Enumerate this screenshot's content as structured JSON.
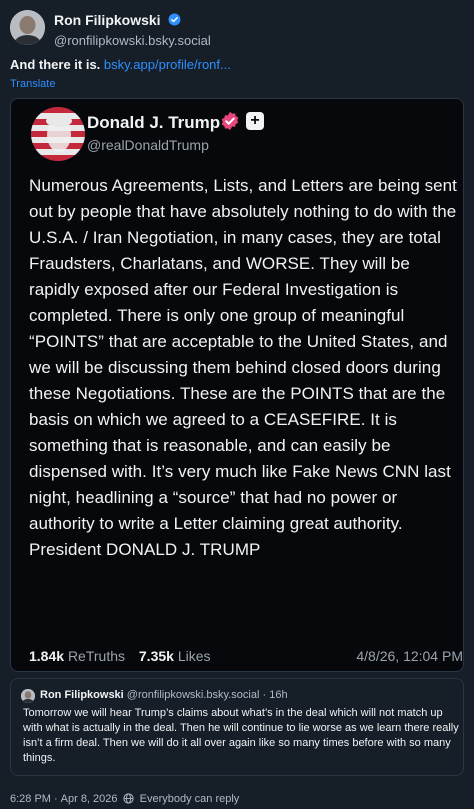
{
  "post": {
    "author_name": "Ron Filipkowski",
    "author_handle": "@ronfilipkowski.bsky.social",
    "text": "And there it is.",
    "link_text": "bsky.app/profile/ronf...",
    "translate_label": "Translate"
  },
  "embed": {
    "author_name": "Donald J. Trump",
    "author_handle": "@realDonaldTrump",
    "body": "Numerous Agreements, Lists, and Letters are being sent out by people that have absolutely nothing to do with the U.S.A. / Iran Negotiation, in many cases, they are total Fraudsters, Charlatans, and WORSE. They will be rapidly exposed after our Federal Investigation is completed. There is only one group of meaningful “POINTS” that are acceptable to the United States, and we will be discussing them behind closed doors during these Negotiations. These are the POINTS that are the basis on which we agreed to a CEASEFIRE. It is something that is reasonable, and can easily be dispensed with. It’s very much like Fake News CNN last night, headlining a “source” that had no power or authority to write a Letter claiming great authority. President DONALD J. TRUMP",
    "retruths_count": "1.84k",
    "retruths_label": "ReTruths",
    "likes_count": "7.35k",
    "likes_label": "Likes",
    "date": "4/8/26, 12:04 PM",
    "follow_symbol": "+"
  },
  "quote": {
    "author_name": "Ron Filipkowski",
    "author_handle": "@ronfilipkowski.bsky.social",
    "separator": "·",
    "age": "16h",
    "body": "Tomorrow we will hear Trump’s claims about what’s in the deal which will not match up with what is actually in the deal. Then he will continue to lie worse as we learn there really isn’t a firm deal. Then we will do it all over again like so many times before with so many things."
  },
  "footer": {
    "time": "6:28 PM",
    "separator": "·",
    "date": "Apr 8, 2026",
    "reply_setting": "Everybody can reply"
  },
  "colors": {
    "background": "#161e27",
    "link": "#2f90ff",
    "verified": "#2f90ff",
    "truth_badge": "#e8467c"
  }
}
